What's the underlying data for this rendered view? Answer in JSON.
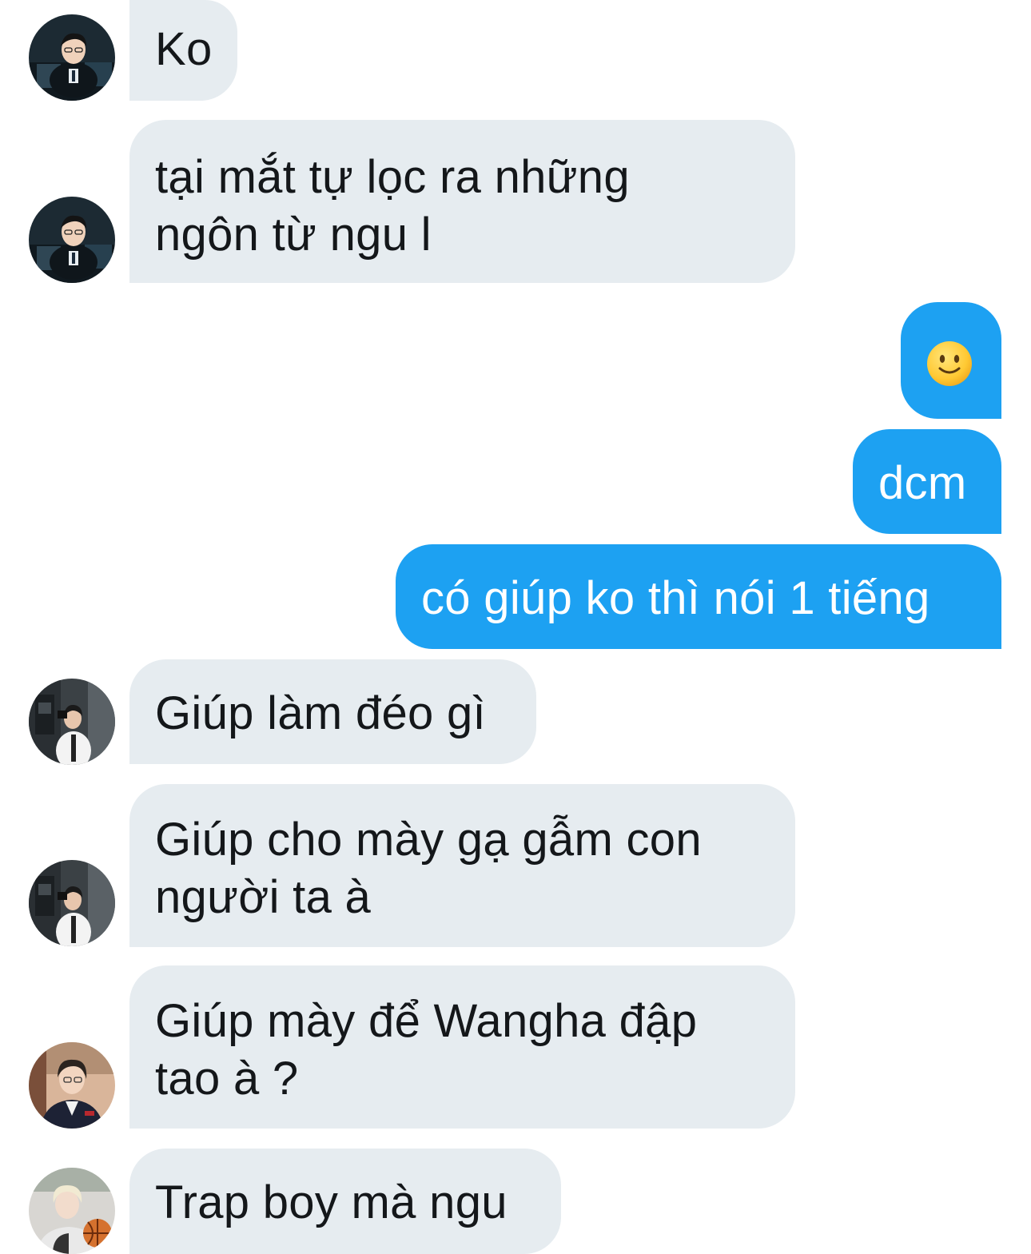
{
  "messages": [
    {
      "direction": "incoming",
      "text": "Ko",
      "avatar": "avatar-1-icon"
    },
    {
      "direction": "incoming",
      "lines": [
        "tại mắt tự lọc ra những",
        "ngôn từ ngu l"
      ],
      "avatar": "avatar-1-icon"
    },
    {
      "direction": "outgoing",
      "emoji": "slightly-smiling-face-icon"
    },
    {
      "direction": "outgoing",
      "text": "dcm"
    },
    {
      "direction": "outgoing",
      "text": "có giúp ko thì nói 1 tiếng"
    },
    {
      "direction": "incoming",
      "text": "Giúp làm đéo gì",
      "avatar": "avatar-2-icon"
    },
    {
      "direction": "incoming",
      "lines": [
        "Giúp cho mày gạ gẫm con",
        "người ta à"
      ],
      "avatar": "avatar-2-icon"
    },
    {
      "direction": "incoming",
      "lines": [
        "Giúp mày để Wangha đập",
        "tao à ?"
      ],
      "avatar": "avatar-3-icon"
    },
    {
      "direction": "incoming",
      "text": "Trap boy mà ngu",
      "avatar": "avatar-4-icon"
    }
  ],
  "colors": {
    "incoming_bubble": "#e6ecf0",
    "incoming_text": "#14171a",
    "outgoing_bubble": "#1da1f2",
    "outgoing_text": "#ffffff"
  }
}
